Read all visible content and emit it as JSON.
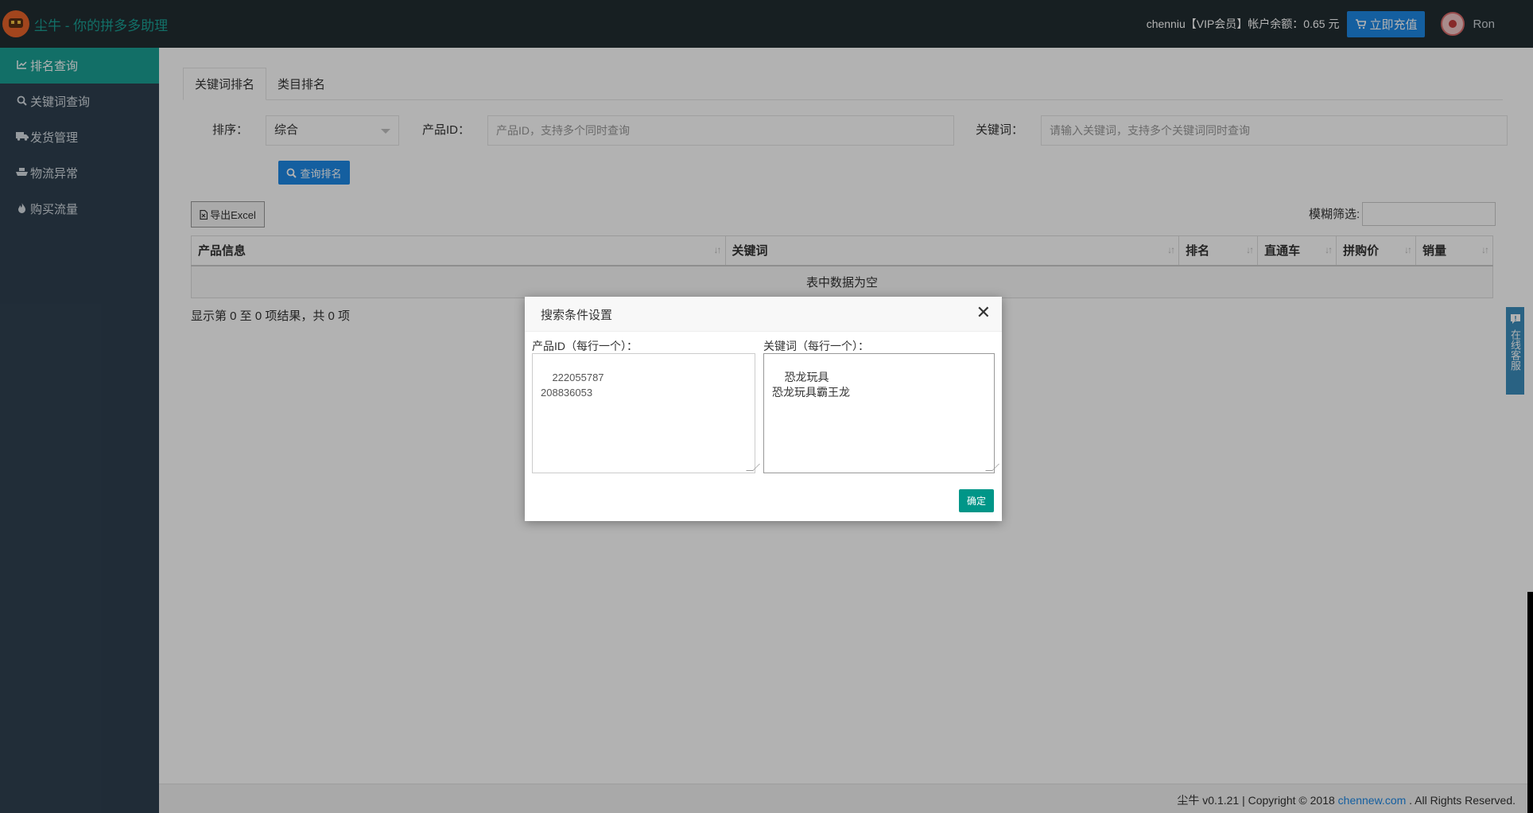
{
  "app": {
    "brand": "尘牛 - 你的拼多多助理",
    "account_text": "chenniu【VIP会员】帐户余额：0.65 元",
    "recharge_label": "立即充值",
    "username": "Ron"
  },
  "sidebar": {
    "items": [
      {
        "label": "排名查询",
        "icon": "chart-line-icon",
        "active": true
      },
      {
        "label": "关键词查询",
        "icon": "search-icon",
        "active": false
      },
      {
        "label": "发货管理",
        "icon": "truck-icon",
        "active": false
      },
      {
        "label": "物流异常",
        "icon": "ship-icon",
        "active": false
      },
      {
        "label": "购买流量",
        "icon": "fire-icon",
        "active": false
      }
    ]
  },
  "tabs": [
    {
      "label": "关键词排名",
      "active": true
    },
    {
      "label": "类目排名",
      "active": false
    }
  ],
  "form": {
    "sort_label": "排序：",
    "sort_value": "综合",
    "product_id_label": "产品ID：",
    "product_id_placeholder": "产品ID，支持多个同时查询",
    "keyword_label": "关键词：",
    "keyword_placeholder": "请输入关键词，支持多个关键词同时查询",
    "query_button": "查询排名"
  },
  "table": {
    "export_button": "导出Excel",
    "filter_label": "模糊筛选:",
    "filter_value": "",
    "columns": [
      "产品信息",
      "关键词",
      "排名",
      "直通车",
      "拼购价",
      "销量"
    ],
    "empty_text": "表中数据为空",
    "info_text": "显示第 0 至 0 项结果，共 0 项"
  },
  "footer": {
    "prefix": "尘牛 v0.1.21 | Copyright © 2018 ",
    "link": "chennew.com",
    "suffix": " . All Rights Reserved."
  },
  "widget": {
    "label": "在线客服"
  },
  "modal": {
    "title": "搜索条件设置",
    "close_glyph": "✕",
    "product_ids_label": "产品ID（每行一个）：",
    "product_ids_value": "222055787\n208836053",
    "keywords_label": "关键词（每行一个）：",
    "keywords_value": "恐龙玩具\n恐龙玩具霸王龙",
    "ok_button": "确定"
  },
  "colors": {
    "accent": "#1aa094",
    "primary": "#1e88e5",
    "sidebar_bg": "#2f4050",
    "topbar_bg": "#222d32",
    "ok_button": "#009688"
  }
}
